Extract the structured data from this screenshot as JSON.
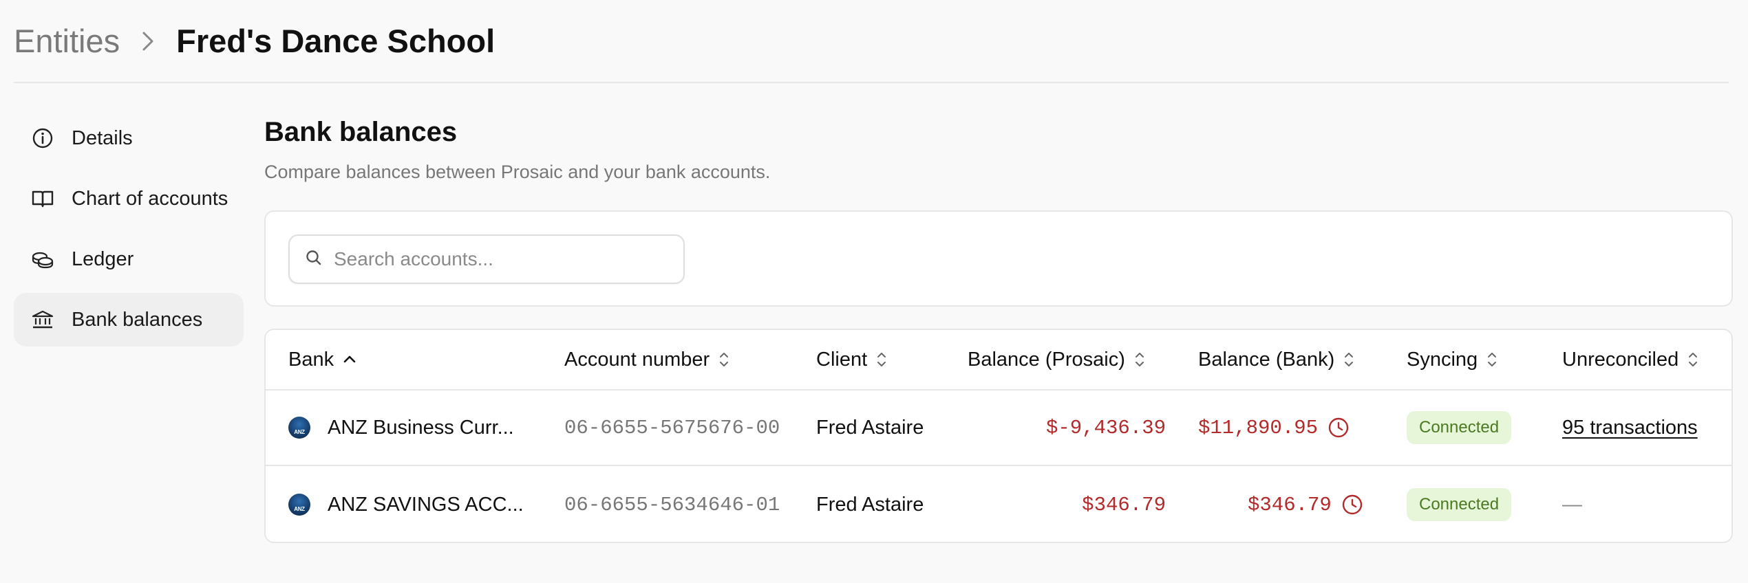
{
  "breadcrumb": {
    "root": "Entities",
    "current": "Fred's Dance School"
  },
  "sidebar": {
    "items": [
      {
        "label": "Details",
        "icon": "info-icon"
      },
      {
        "label": "Chart of accounts",
        "icon": "book-icon"
      },
      {
        "label": "Ledger",
        "icon": "coins-icon"
      },
      {
        "label": "Bank balances",
        "icon": "bank-icon",
        "active": true
      }
    ]
  },
  "page": {
    "title": "Bank balances",
    "subtitle": "Compare balances between Prosaic and your bank accounts."
  },
  "search": {
    "placeholder": "Search accounts...",
    "value": ""
  },
  "table": {
    "columns": [
      "Bank",
      "Account number",
      "Client",
      "Balance (Prosaic)",
      "Balance (Bank)",
      "Syncing",
      "Unreconciled"
    ],
    "sorted_column": "Bank",
    "sort_direction": "ascending",
    "rows": [
      {
        "bank": "ANZ Business Curr...",
        "bank_logo": "ANZ",
        "account_number": "06-6655-5675676-00",
        "client": "Fred Astaire",
        "balance_prosaic": "$-9,436.39",
        "balance_bank": "$11,890.95",
        "syncing": "Connected",
        "unreconciled": "95 transactions"
      },
      {
        "bank": "ANZ SAVINGS ACC...",
        "bank_logo": "ANZ",
        "account_number": "06-6655-5634646-01",
        "client": "Fred Astaire",
        "balance_prosaic": "$346.79",
        "balance_bank": "$346.79",
        "syncing": "Connected",
        "unreconciled": "—"
      }
    ]
  },
  "colors": {
    "negative_amount": "#b22a2a",
    "badge_bg": "#e7f5d9",
    "badge_text": "#4a7a22",
    "active_nav_bg": "#efefef"
  }
}
